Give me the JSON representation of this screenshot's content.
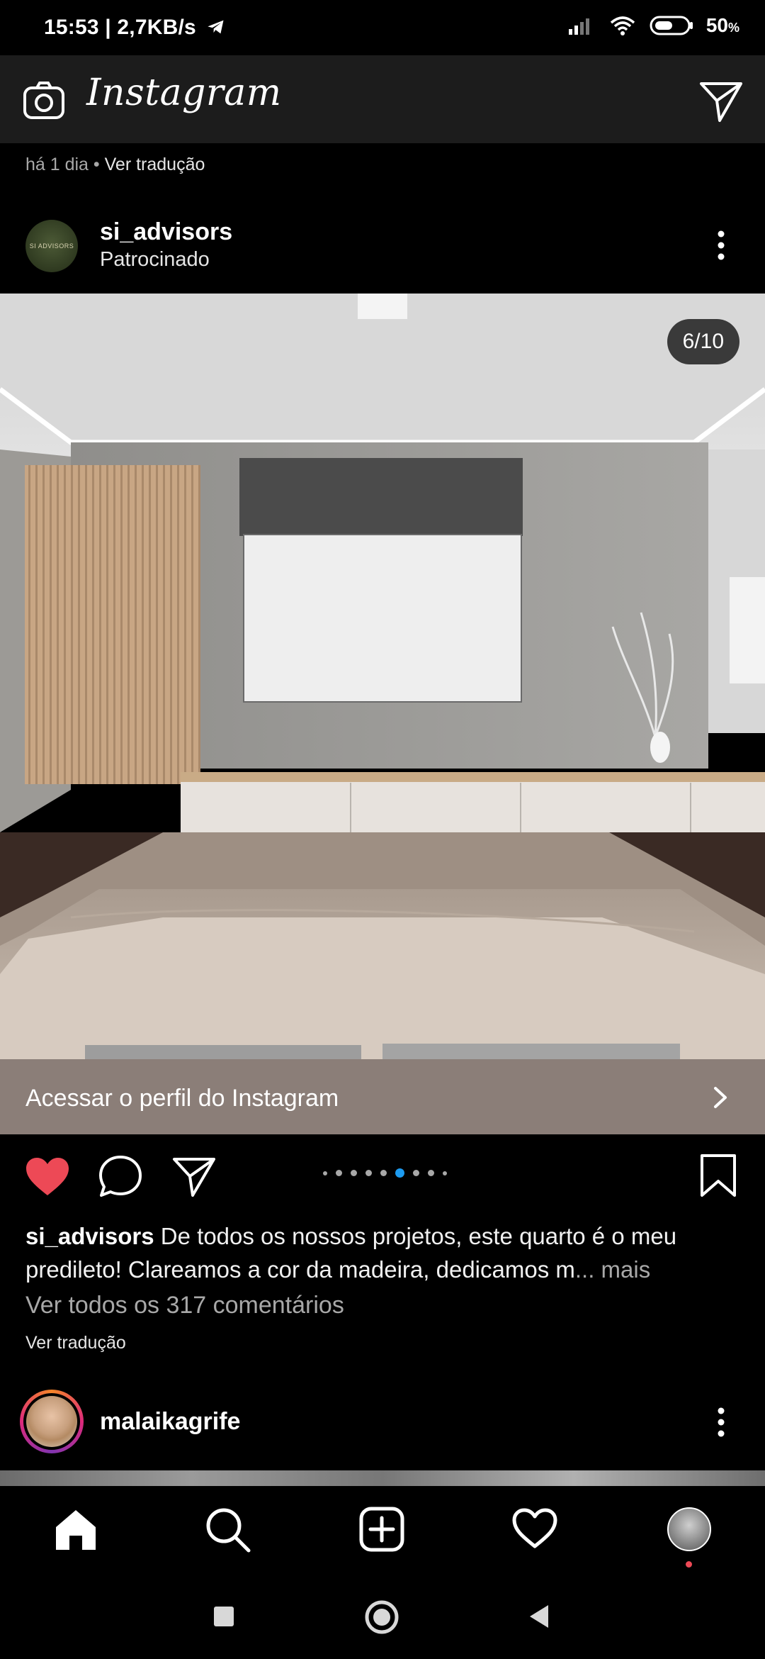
{
  "status_bar": {
    "time": "15:53",
    "speed": "2,7KB/s",
    "battery": "50"
  },
  "header": {
    "brand": "Instagram"
  },
  "previous_post": {
    "time_ago": "há 1 dia",
    "translate_link": "Ver tradução"
  },
  "post": {
    "username": "si_advisors",
    "sponsored_label": "Patrocinado",
    "avatar_text": "SI ADVISORS",
    "image_counter": "6/10",
    "cta_label": "Acessar o perfil do Instagram",
    "carousel": {
      "total_dots": 9,
      "active_index": 5
    },
    "liked": true,
    "caption_username": "si_advisors",
    "caption_text": " De todos os nossos projetos, este quarto é o meu predileto! Clareamos a cor da madeira, dedicamos m",
    "caption_more": "... mais",
    "comments_link": "Ver todos os 317 comentários",
    "translate_link": "Ver tradução"
  },
  "next_post": {
    "username": "malaikagrife"
  },
  "bottom_nav": {
    "items": [
      "home-icon",
      "search-icon",
      "new-post-icon",
      "activity-icon",
      "profile-icon"
    ]
  },
  "colors": {
    "like": "#ed4956",
    "carousel_active": "#1d9bf0",
    "cta_background": "#8b7e78"
  }
}
